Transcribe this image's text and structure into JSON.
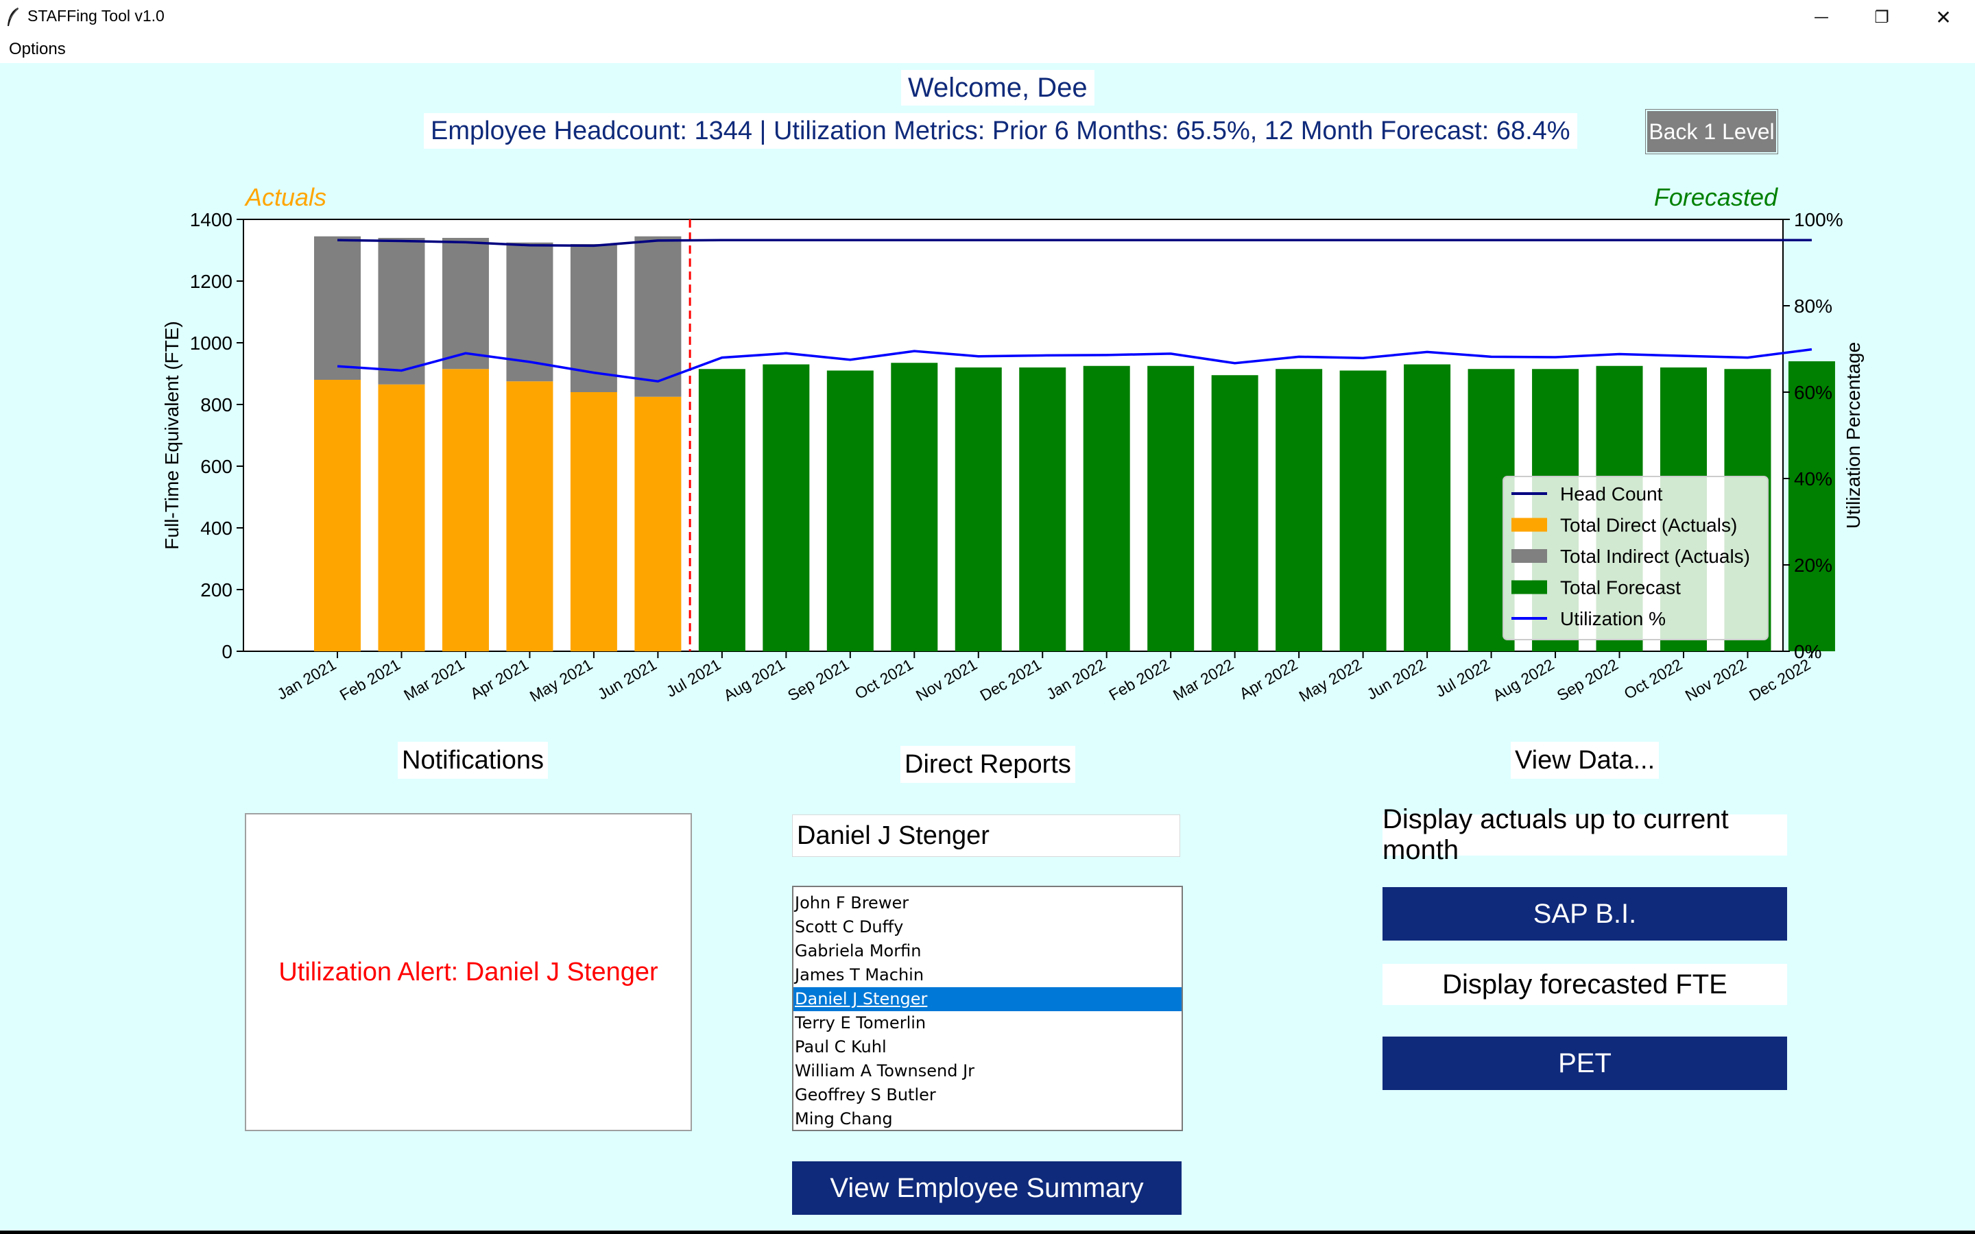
{
  "window": {
    "title": "STAFFing Tool v1.0",
    "controls": {
      "minimize": "—",
      "restore": "❐",
      "close": "✕"
    }
  },
  "menu": {
    "options": "Options"
  },
  "header": {
    "welcome": "Welcome, Dee",
    "metrics": "Employee Headcount: 1344 | Utilization Metrics: Prior 6 Months: 65.5%, 12 Month Forecast: 68.4%",
    "back_button": "Back 1 Level"
  },
  "chart_data": {
    "type": "bar",
    "actuals_label": "Actuals",
    "forecast_label": "Forecasted",
    "ylabel": "Full-Time Equivalent (FTE)",
    "y2label": "Utilization Percentage",
    "ylim": [
      0,
      1400
    ],
    "y2lim": [
      0,
      100
    ],
    "yticks": [
      "0",
      "200",
      "400",
      "600",
      "800",
      "1000",
      "1200",
      "1400"
    ],
    "y2ticks": [
      "0%",
      "20%",
      "40%",
      "60%",
      "80%",
      "100%"
    ],
    "categories": [
      "Jan 2021",
      "Feb 2021",
      "Mar 2021",
      "Apr 2021",
      "May 2021",
      "Jun 2021",
      "Jul 2021",
      "Aug 2021",
      "Sep 2021",
      "Oct 2021",
      "Nov 2021",
      "Dec 2021",
      "Jan 2022",
      "Feb 2022",
      "Mar 2022",
      "Apr 2022",
      "May 2022",
      "Jun 2022",
      "Jul 2022",
      "Aug 2022",
      "Sep 2022",
      "Oct 2022",
      "Nov 2022",
      "Dec 2022"
    ],
    "actual_months": 6,
    "series": [
      {
        "name": "Head Count",
        "axis": "percent",
        "values": [
          95.2,
          95.0,
          94.7,
          94.0,
          93.9,
          95.1,
          95.2,
          95.2,
          95.2,
          95.2,
          95.2,
          95.2,
          95.2,
          95.2,
          95.2,
          95.2,
          95.2,
          95.2,
          95.2,
          95.2,
          95.2,
          95.2,
          95.2,
          95.2
        ]
      },
      {
        "name": "Total Direct (Actuals)",
        "values": [
          880,
          865,
          915,
          875,
          840,
          825
        ]
      },
      {
        "name": "Total Indirect (Actuals)",
        "values": [
          465,
          475,
          425,
          450,
          480,
          520
        ]
      },
      {
        "name": "Total Forecast",
        "offset": 6,
        "values": [
          915,
          930,
          910,
          935,
          920,
          920,
          925,
          925,
          895,
          915,
          910,
          930,
          915,
          915,
          925,
          920,
          915,
          940
        ]
      },
      {
        "name": "Utilization %",
        "axis": "percent",
        "values": [
          66.0,
          65.0,
          69.0,
          67.0,
          64.5,
          62.5,
          68.0,
          69.0,
          67.5,
          69.5,
          68.3,
          68.5,
          68.6,
          68.9,
          66.7,
          68.2,
          67.9,
          69.3,
          68.2,
          68.1,
          68.8,
          68.4,
          68.0,
          69.9
        ]
      }
    ],
    "colors": {
      "direct": "#ffa500",
      "indirect": "#808080",
      "forecast": "#008000",
      "headcount": "#000080",
      "utilization": "#0000ff",
      "divider": "#ff0000"
    },
    "legend_position": "lower-right",
    "grid": false
  },
  "notifications": {
    "title": "Notifications",
    "alert": "Utilization Alert: Daniel J Stenger"
  },
  "direct_reports": {
    "title": "Direct Reports",
    "selected_name": "Daniel J Stenger",
    "items": [
      "John F Brewer",
      "Scott C Duffy",
      "Gabriela Morfin",
      "James T Machin",
      "Daniel J Stenger",
      "Terry E Tomerlin",
      "Paul C Kuhl",
      "William A Townsend Jr",
      "Geoffrey S Butler",
      "Ming Chang"
    ],
    "selected_index": 4,
    "summary_button": "View Employee Summary"
  },
  "view_data": {
    "title": "View Data...",
    "actuals_label": "Display actuals up to current month",
    "sap_button": "SAP B.I.",
    "forecast_label": "Display forecasted FTE",
    "pet_button": "PET"
  }
}
